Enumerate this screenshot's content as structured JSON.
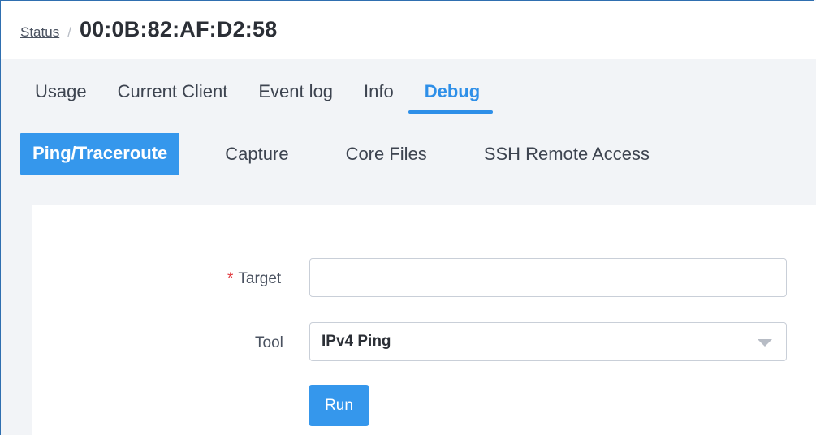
{
  "breadcrumb": {
    "link_label": "Status",
    "separator": "/",
    "title": "00:0B:82:AF:D2:58"
  },
  "tabs": [
    {
      "label": "Usage",
      "active": false
    },
    {
      "label": "Current Client",
      "active": false
    },
    {
      "label": "Event log",
      "active": false
    },
    {
      "label": "Info",
      "active": false
    },
    {
      "label": "Debug",
      "active": true
    }
  ],
  "subtabs": [
    {
      "label": "Ping/Traceroute",
      "active": true
    },
    {
      "label": "Capture",
      "active": false
    },
    {
      "label": "Core Files",
      "active": false
    },
    {
      "label": "SSH Remote Access",
      "active": false
    }
  ],
  "form": {
    "target": {
      "required_mark": "*",
      "label": "Target",
      "value": "",
      "placeholder": ""
    },
    "tool": {
      "label": "Tool",
      "selected": "IPv4 Ping"
    },
    "run_label": "Run"
  },
  "colors": {
    "accent": "#2e8fe8",
    "button": "#3597ec",
    "required": "#e0393e",
    "background": "#f2f4f7"
  },
  "icons": {
    "tool_dropdown": "chevron-down-icon"
  }
}
